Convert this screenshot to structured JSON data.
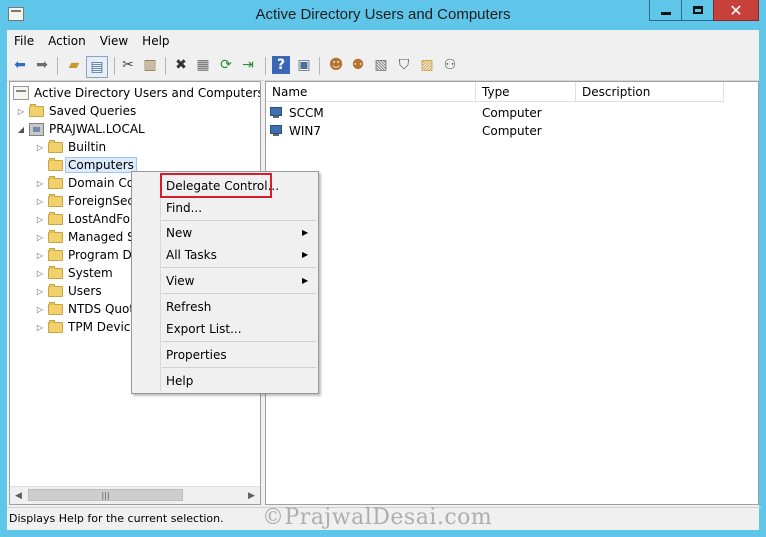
{
  "window": {
    "title": "Active Directory Users and Computers",
    "minimize_label": "",
    "maximize_label": "",
    "close_label": "✕"
  },
  "menubar": [
    "File",
    "Action",
    "View",
    "Help"
  ],
  "tree": {
    "root": "Active Directory Users and Computers [AD.",
    "saved_queries": "Saved Queries",
    "domain": "PRAJWAL.LOCAL",
    "children": [
      "Builtin",
      "Computers",
      "Domain Co",
      "ForeignSecu",
      "LostAndFou",
      "Managed S",
      "Program Da",
      "System",
      "Users",
      "NTDS Quot",
      "TPM Device"
    ]
  },
  "list": {
    "columns": [
      "Name",
      "Type",
      "Description"
    ],
    "rows": [
      {
        "name": "SCCM",
        "type": "Computer",
        "description": ""
      },
      {
        "name": "WIN7",
        "type": "Computer",
        "description": ""
      }
    ]
  },
  "context_menu": {
    "delegate": "Delegate Control...",
    "find": "Find...",
    "new": "New",
    "all_tasks": "All Tasks",
    "view": "View",
    "refresh": "Refresh",
    "export": "Export List...",
    "properties": "Properties",
    "help": "Help"
  },
  "status": "Displays Help for the current selection.",
  "watermark": "©PrajwalDesai.com",
  "colors": {
    "titlebar": "#5fc6ea",
    "close_button": "#c7413a",
    "highlight_box": "#d21f2a"
  }
}
